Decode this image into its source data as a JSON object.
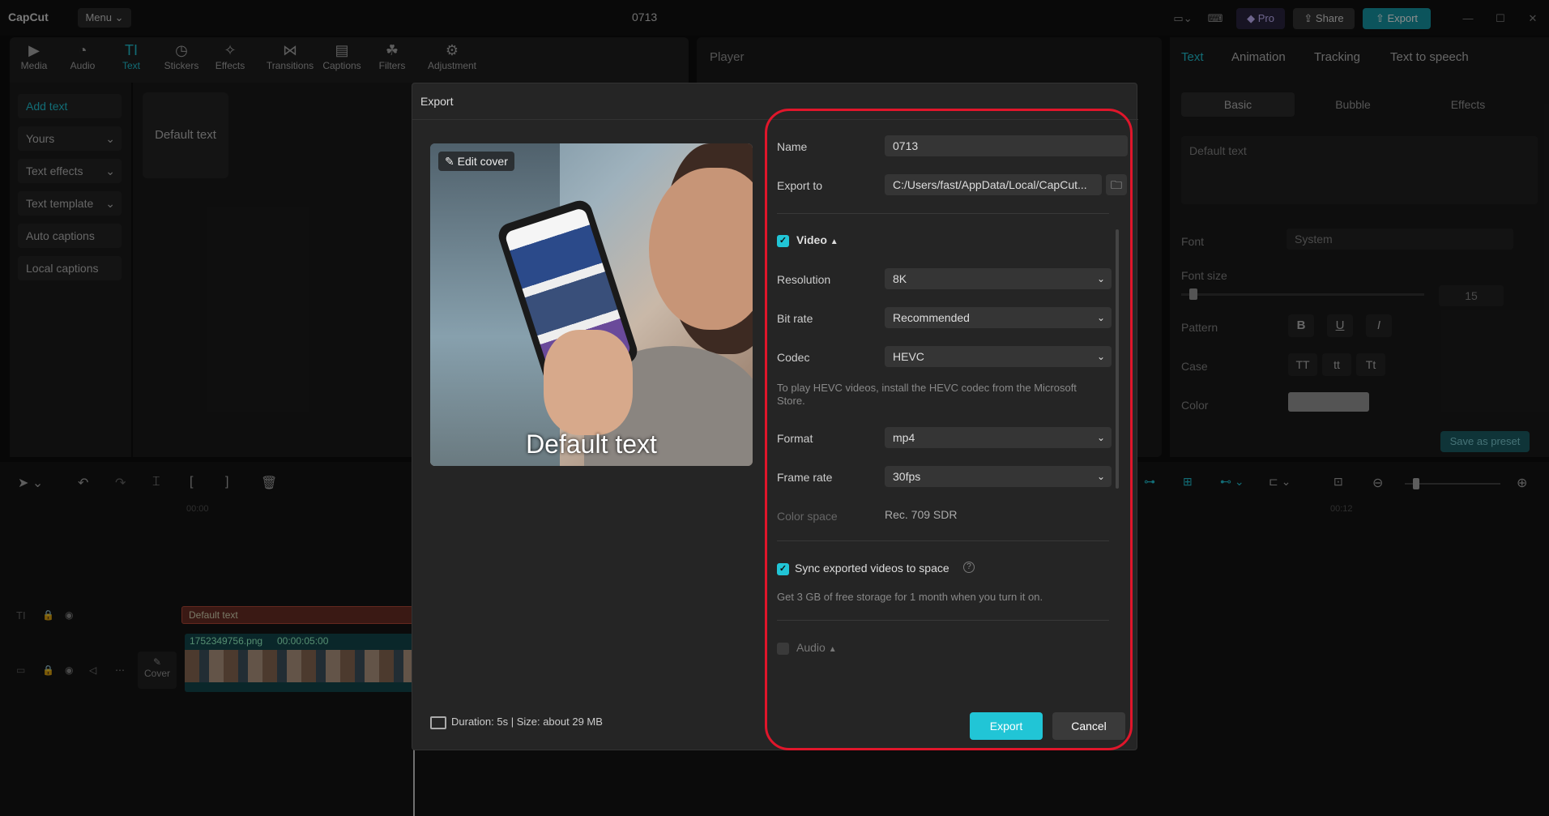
{
  "app": {
    "logo": "CapCut",
    "menu": "Menu",
    "project_title": "0713",
    "pro": "Pro",
    "share": "Share",
    "export": "Export"
  },
  "toolbar": {
    "items": [
      "Media",
      "Audio",
      "Text",
      "Stickers",
      "Effects",
      "Transitions",
      "Captions",
      "Filters",
      "Adjustment"
    ]
  },
  "left_panel": {
    "items": [
      "Add text",
      "Yours",
      "Text effects",
      "Text template",
      "Auto captions",
      "Local captions"
    ]
  },
  "text_panel": {
    "default_card": "Default text"
  },
  "player": {
    "title": "Player"
  },
  "props": {
    "tabs": [
      "Text",
      "Animation",
      "Tracking",
      "Text to speech"
    ],
    "segments": [
      "Basic",
      "Bubble",
      "Effects"
    ],
    "textarea": "Default text",
    "font_label": "Font",
    "font_value": "System",
    "font_size_label": "Font size",
    "font_size_value": "15",
    "pattern_label": "Pattern",
    "pattern_buttons": [
      "B",
      "U",
      "I"
    ],
    "case_label": "Case",
    "case_buttons": [
      "TT",
      "tt",
      "Tt"
    ],
    "color_label": "Color",
    "color_value": "#9a9a9a",
    "save_preset": "Save as preset"
  },
  "timeline": {
    "time_start": "00:00",
    "time_end": "00:12",
    "text_clip": "Default text",
    "video_clip_name": "1752349756.png",
    "video_clip_duration": "00:00:05:00",
    "cover_label": "Cover"
  },
  "export_dialog": {
    "title": "Export",
    "edit_cover": "Edit cover",
    "cover_text": "Default text",
    "duration_info": "Duration: 5s | Size: about 29 MB",
    "name_label": "Name",
    "name_value": "0713",
    "export_to_label": "Export to",
    "export_to_value": "C:/Users/fast/AppData/Local/CapCut...",
    "video_section": "Video",
    "resolution_label": "Resolution",
    "resolution_value": "8K",
    "bitrate_label": "Bit rate",
    "bitrate_value": "Recommended",
    "codec_label": "Codec",
    "codec_value": "HEVC",
    "codec_note": "To play HEVC videos, install the HEVC codec from the Microsoft Store.",
    "format_label": "Format",
    "format_value": "mp4",
    "framerate_label": "Frame rate",
    "framerate_value": "30fps",
    "colorspace_label": "Color space",
    "colorspace_value": "Rec. 709 SDR",
    "sync_label": "Sync exported videos to space",
    "sync_note": "Get 3 GB of free storage for 1 month when you turn it on.",
    "audio_section": "Audio",
    "export_button": "Export",
    "cancel_button": "Cancel"
  },
  "colors": {
    "accent": "#21c5d6",
    "highlight": "#e0162b"
  }
}
